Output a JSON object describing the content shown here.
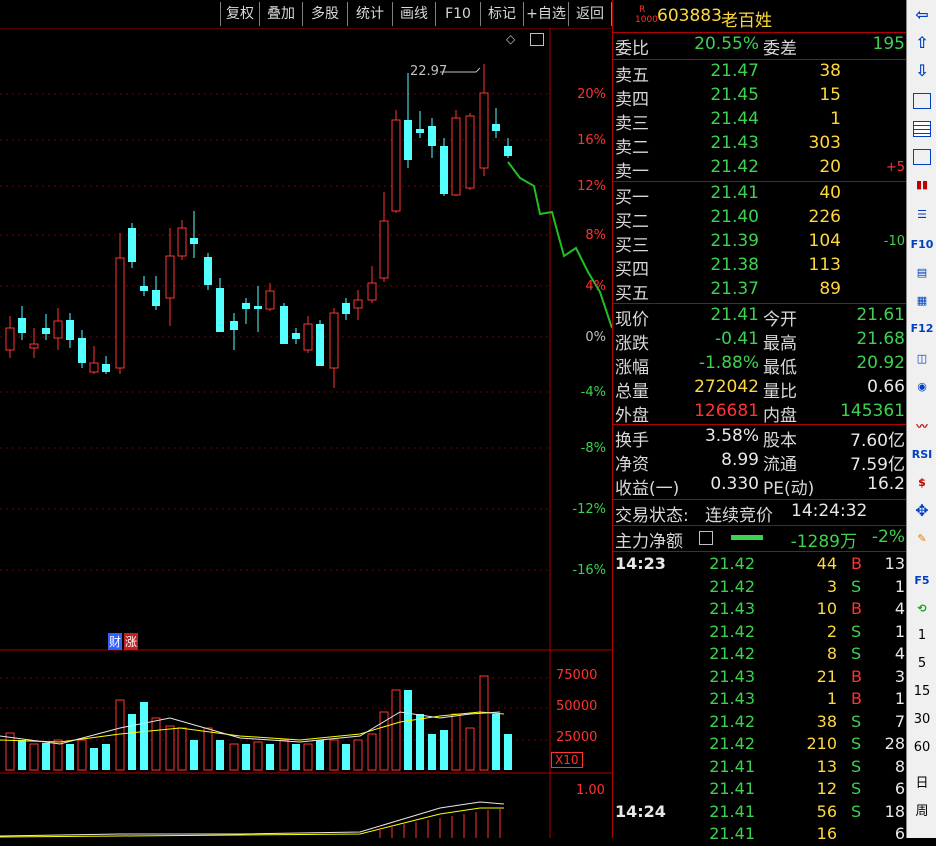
{
  "toolbar": {
    "buttons": [
      "复权",
      "叠加",
      "多股",
      "统计",
      "画线",
      "F10",
      "标记",
      "+自选",
      "返回"
    ]
  },
  "chart": {
    "pct_labels": [
      "20%",
      "16%",
      "12%",
      "8%",
      "4%",
      "0%",
      "-4%",
      "-8%",
      "-12%",
      "-16%"
    ],
    "high_label": "22.97",
    "fin_label": "财",
    "zhang_label": "涨",
    "vol_labels": [
      "75000",
      "50000",
      "25000"
    ],
    "vol_unit": "X10",
    "macd_label": "1.00"
  },
  "stock": {
    "market_tag": "R",
    "market_sub": "1000",
    "code": "603883",
    "name": "老百姓"
  },
  "ratio": {
    "weibi_label": "委比",
    "weibi": "20.55%",
    "weicha_label": "委差",
    "weicha": "195"
  },
  "asks": [
    {
      "label": "卖五",
      "price": "21.47",
      "vol": "38",
      "chg": ""
    },
    {
      "label": "卖四",
      "price": "21.45",
      "vol": "15",
      "chg": ""
    },
    {
      "label": "卖三",
      "price": "21.44",
      "vol": "1",
      "chg": ""
    },
    {
      "label": "卖二",
      "price": "21.43",
      "vol": "303",
      "chg": ""
    },
    {
      "label": "卖一",
      "price": "21.42",
      "vol": "20",
      "chg": "+5"
    }
  ],
  "bids": [
    {
      "label": "买一",
      "price": "21.41",
      "vol": "40",
      "chg": ""
    },
    {
      "label": "买二",
      "price": "21.40",
      "vol": "226",
      "chg": ""
    },
    {
      "label": "买三",
      "price": "21.39",
      "vol": "104",
      "chg": "-10"
    },
    {
      "label": "买四",
      "price": "21.38",
      "vol": "113",
      "chg": ""
    },
    {
      "label": "买五",
      "price": "21.37",
      "vol": "89",
      "chg": ""
    }
  ],
  "quote": [
    {
      "l1": "现价",
      "v1": "21.41",
      "l2": "今开",
      "v2": "21.61"
    },
    {
      "l1": "涨跌",
      "v1": "-0.41",
      "l2": "最高",
      "v2": "21.68"
    },
    {
      "l1": "涨幅",
      "v1": "-1.88%",
      "l2": "最低",
      "v2": "20.92"
    },
    {
      "l1": "总量",
      "v1": "272042",
      "l2": "量比",
      "v2": "0.66"
    },
    {
      "l1": "外盘",
      "v1": "126681",
      "l2": "内盘",
      "v2": "145361"
    }
  ],
  "quote2": [
    {
      "l1": "换手",
      "v1": "3.58%",
      "l2": "股本",
      "v2": "7.60亿"
    },
    {
      "l1": "净资",
      "v1": "8.99",
      "l2": "流通",
      "v2": "7.59亿"
    },
    {
      "l1": "收益(一)",
      "v1": "0.330",
      "l2": "PE(动)",
      "v2": "16.2"
    }
  ],
  "status": {
    "label": "交易状态:",
    "value": "连续竞价",
    "time": "14:24:32"
  },
  "mainforce": {
    "label": "主力净额",
    "value": "-1289万",
    "pct": "-2%"
  },
  "ticks": [
    {
      "time": "14:23",
      "price": "21.42",
      "vol": "44",
      "side": "B",
      "n": "13"
    },
    {
      "time": "",
      "price": "21.42",
      "vol": "3",
      "side": "S",
      "n": "1"
    },
    {
      "time": "",
      "price": "21.43",
      "vol": "10",
      "side": "B",
      "n": "4"
    },
    {
      "time": "",
      "price": "21.42",
      "vol": "2",
      "side": "S",
      "n": "1"
    },
    {
      "time": "",
      "price": "21.42",
      "vol": "8",
      "side": "S",
      "n": "4"
    },
    {
      "time": "",
      "price": "21.43",
      "vol": "21",
      "side": "B",
      "n": "3"
    },
    {
      "time": "",
      "price": "21.43",
      "vol": "1",
      "side": "B",
      "n": "1"
    },
    {
      "time": "",
      "price": "21.42",
      "vol": "38",
      "side": "S",
      "n": "7"
    },
    {
      "time": "",
      "price": "21.42",
      "vol": "210",
      "side": "S",
      "n": "28"
    },
    {
      "time": "",
      "price": "21.41",
      "vol": "13",
      "side": "S",
      "n": "8"
    },
    {
      "time": "",
      "price": "21.41",
      "vol": "12",
      "side": "S",
      "n": "6"
    },
    {
      "time": "14:24",
      "price": "21.41",
      "vol": "56",
      "side": "S",
      "n": "18"
    },
    {
      "time": "",
      "price": "21.41",
      "vol": "16",
      "side": "",
      "n": "6"
    }
  ],
  "side": {
    "periods": [
      "1",
      "5",
      "15",
      "30",
      "60",
      "日",
      "周"
    ],
    "rsi": "RSI",
    "f5": "F5",
    "f10": "F10",
    "f12": "F12"
  }
}
